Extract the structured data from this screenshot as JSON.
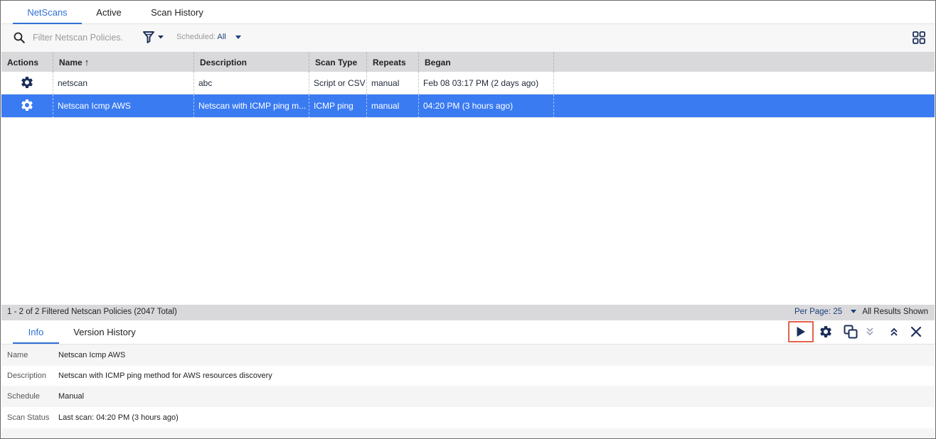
{
  "tabs": [
    {
      "label": "NetScans",
      "active": true
    },
    {
      "label": "Active",
      "active": false
    },
    {
      "label": "Scan History",
      "active": false
    }
  ],
  "toolbar": {
    "search_placeholder": "Filter Netscan Policies.",
    "scheduled_label": "Scheduled:",
    "scheduled_value": "All"
  },
  "table": {
    "columns": [
      "Actions",
      "Name",
      "Description",
      "Scan Type",
      "Repeats",
      "Began"
    ],
    "sort_indicator": "↑",
    "rows": [
      {
        "name": "netscan",
        "description": "abc",
        "scan_type": "Script or CSV",
        "repeats": "manual",
        "began": "Feb 08 03:17 PM  (2 days ago)",
        "selected": false
      },
      {
        "name": "Netscan Icmp AWS",
        "description": "Netscan with ICMP ping m...",
        "scan_type": "ICMP ping",
        "repeats": "manual",
        "began": "04:20 PM  (3 hours ago)",
        "selected": true
      }
    ]
  },
  "footer": {
    "count": "1 - 2 of 2 Filtered Netscan Policies (2047 Total)",
    "per_page": "Per Page: 25",
    "all_results": "All Results Shown"
  },
  "detail": {
    "tabs": [
      {
        "label": "Info",
        "active": true
      },
      {
        "label": "Version History",
        "active": false
      }
    ],
    "fields": [
      {
        "key": "Name",
        "value": "Netscan Icmp AWS"
      },
      {
        "key": "Description",
        "value": "Netscan with ICMP ping method for AWS resources discovery"
      },
      {
        "key": "Schedule",
        "value": "Manual"
      },
      {
        "key": "Scan Status",
        "value": "Last scan: 04:20 PM  (3 hours ago)"
      }
    ],
    "action_icons": [
      "play-icon",
      "gear-icon",
      "clone-icon",
      "double-chevron-down-icon",
      "double-chevron-up-icon",
      "close-icon"
    ]
  },
  "colors": {
    "accent": "#2f6fd4",
    "selected_row": "#3a7bf2",
    "icon_navy": "#1c2f5a",
    "highlight_border": "#e5614e"
  }
}
